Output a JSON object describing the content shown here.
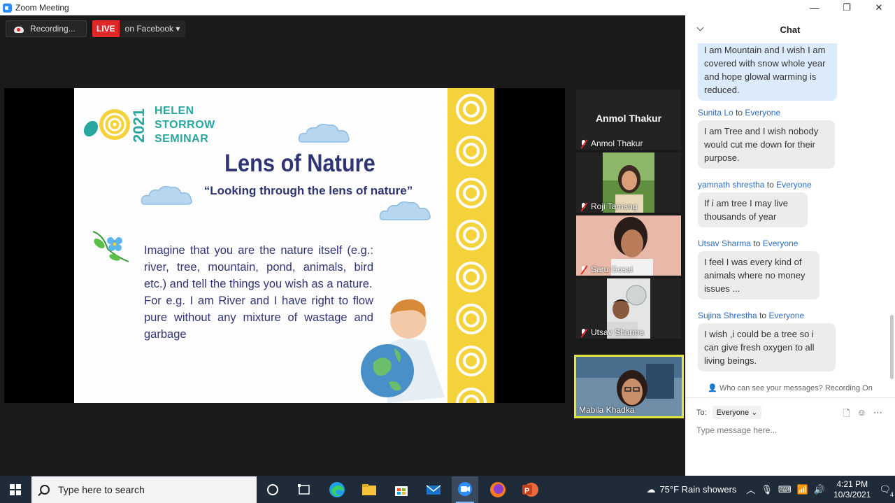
{
  "window": {
    "title": "Zoom Meeting",
    "controls": [
      "—",
      "❐",
      "✕"
    ]
  },
  "meeting_bar": {
    "recording_label": "Recording...",
    "live_label": "LIVE",
    "live_target": "on Facebook ▾"
  },
  "slide": {
    "brand_year": "2021",
    "brand_lines": [
      "HELEN",
      "STORROW",
      "SEMINAR"
    ],
    "title": "Lens of Nature",
    "subtitle": "“Looking through the lens of nature”",
    "body_1": "Imagine that you are the nature itself (e.g.: river, tree, mountain, pond, animals, bird etc.) and tell the things you wish as a nature.",
    "body_2": "For e.g. I am River and I have right to flow pure without any mixture of wastage and garbage"
  },
  "participants": [
    {
      "name": "Anmol Thakur",
      "display": "Anmol Thakur",
      "muted": true
    },
    {
      "name": "Roji Tamang",
      "muted": true
    },
    {
      "name": "Saru Gosai",
      "muted": true
    },
    {
      "name": "Utsav Sharma",
      "muted": true
    },
    {
      "name": "Mabila Khadka",
      "muted": false,
      "speaking": true
    }
  ],
  "chat": {
    "title": "Chat",
    "to_word": "to",
    "messages": [
      {
        "sender": "",
        "recipient": "",
        "text": "I am Mountain and I wish I am covered with snow whole year and hope glowal warming is reduced.",
        "own": true
      },
      {
        "sender": "Sunita Lo",
        "recipient": "Everyone",
        "text": "I am Tree and I wish nobody would cut me down for their purpose."
      },
      {
        "sender": "yamnath shrestha",
        "recipient": "Everyone",
        "text": "If i am tree   I may live thousands of year"
      },
      {
        "sender": "Utsav Sharma",
        "recipient": "Everyone",
        "text": "I feel I was every kind of animals where no money issues ..."
      },
      {
        "sender": "Sujina Shrestha",
        "recipient": "Everyone",
        "text": "I wish ,i could be a tree so i can give fresh oxygen   to all living beings."
      }
    ],
    "visibility_note": "Who can see your messages? Recording On",
    "to_label": "To:",
    "to_value": "Everyone",
    "input_placeholder": "Type message here..."
  },
  "taskbar": {
    "search_placeholder": "Type here to search",
    "weather": "75°F  Rain showers",
    "time": "4:21 PM",
    "date": "10/3/2021",
    "notification_count": "4"
  }
}
